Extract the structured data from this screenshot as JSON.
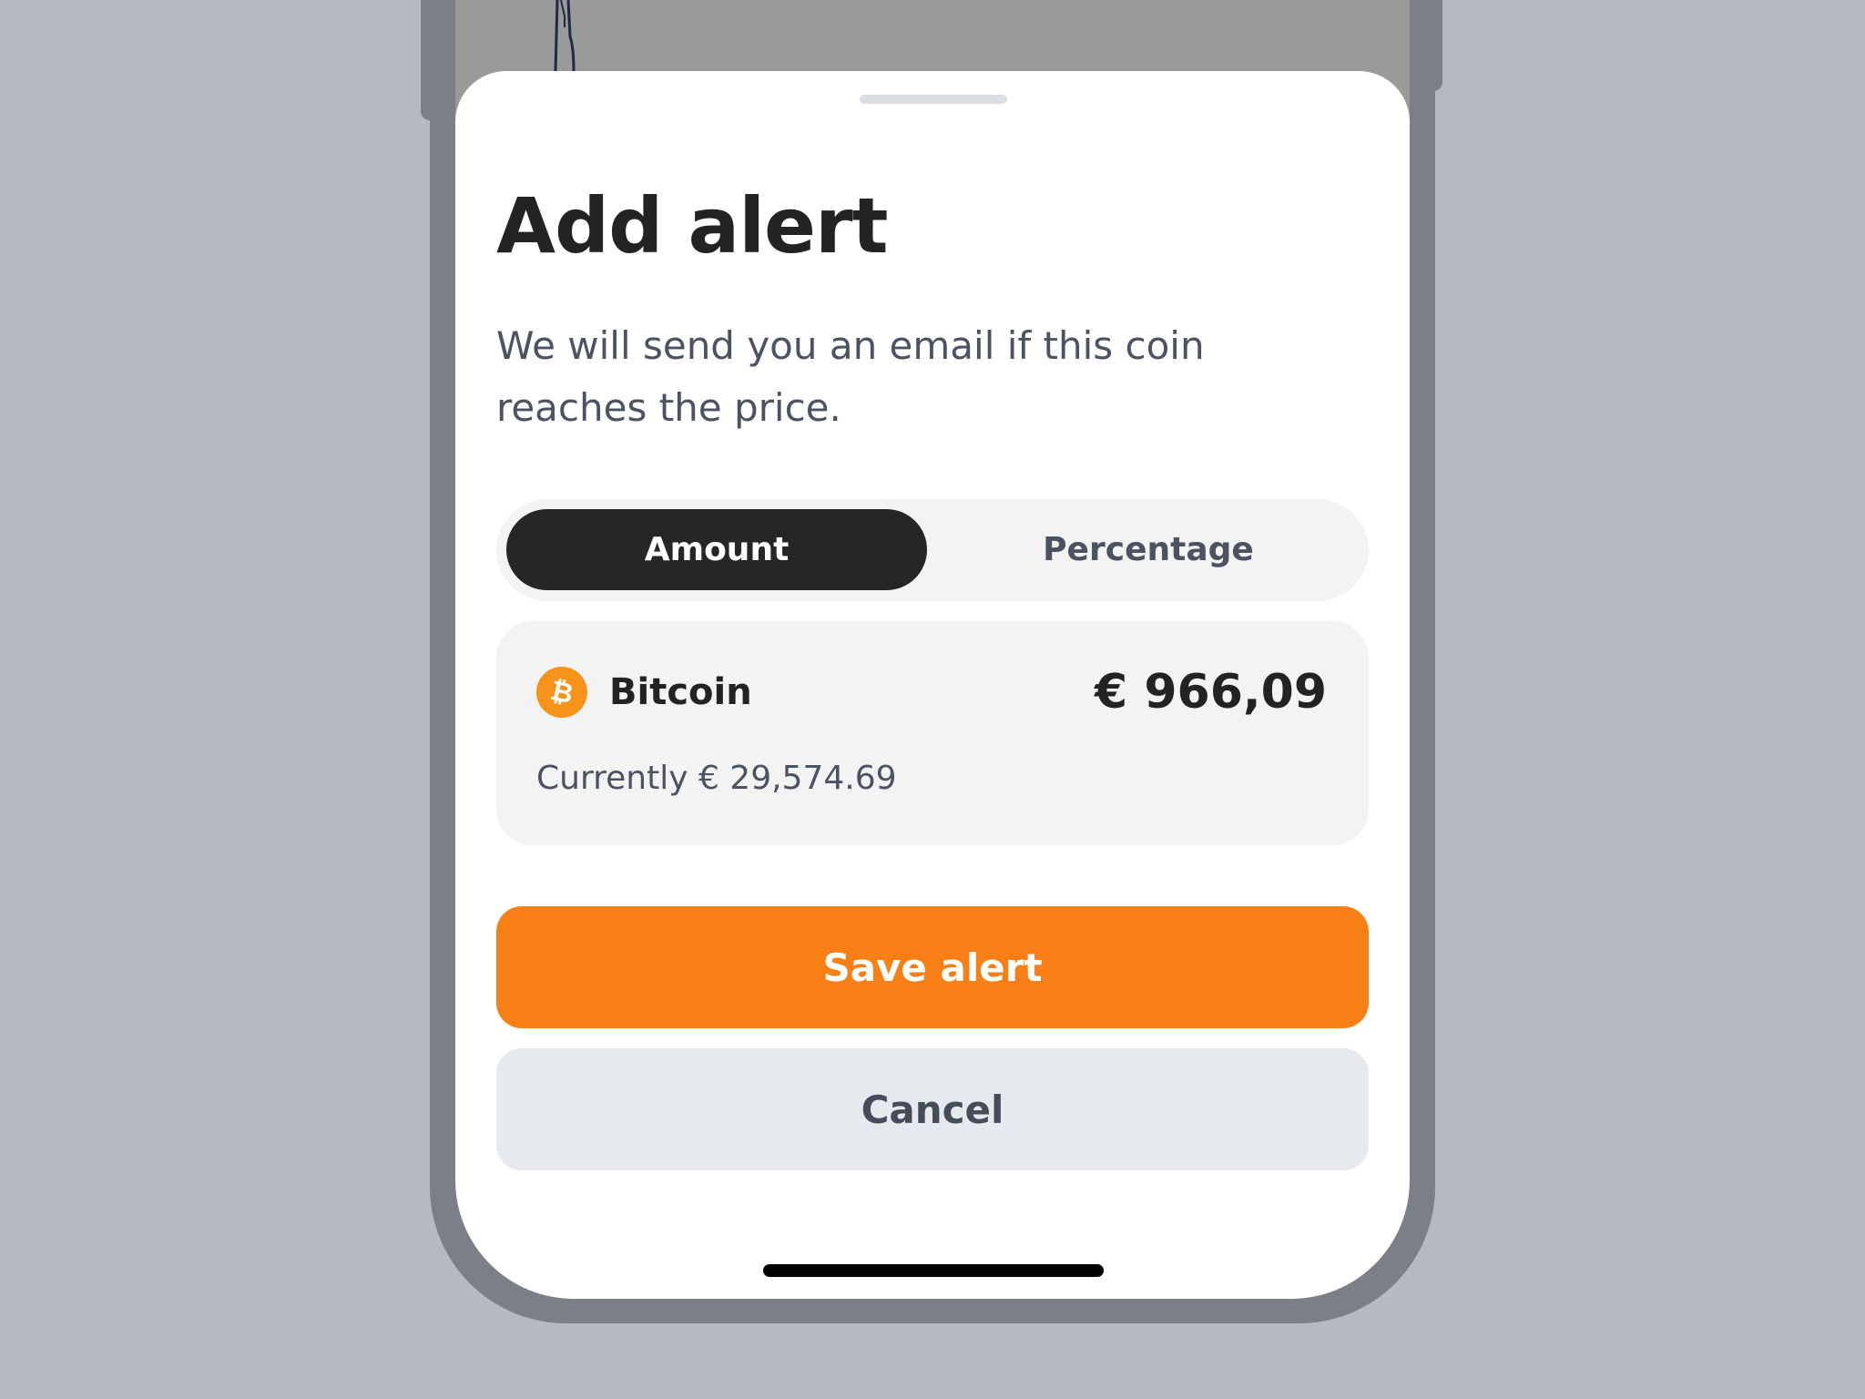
{
  "sheet": {
    "title": "Add alert",
    "description": "We will send you an email if this coin reaches the price."
  },
  "segmented_control": {
    "options": [
      "Amount",
      "Percentage"
    ],
    "selected": "Amount"
  },
  "coin_card": {
    "icon": "bitcoin-icon",
    "symbol_glyph": "₿",
    "name": "Bitcoin",
    "alert_amount": "€ 966,09",
    "current_price": "Currently € 29,574.69"
  },
  "actions": {
    "save_label": "Save alert",
    "cancel_label": "Cancel"
  },
  "colors": {
    "accent": "#f77f16",
    "bitcoin": "#f7931a",
    "segment_active": "#262626"
  }
}
